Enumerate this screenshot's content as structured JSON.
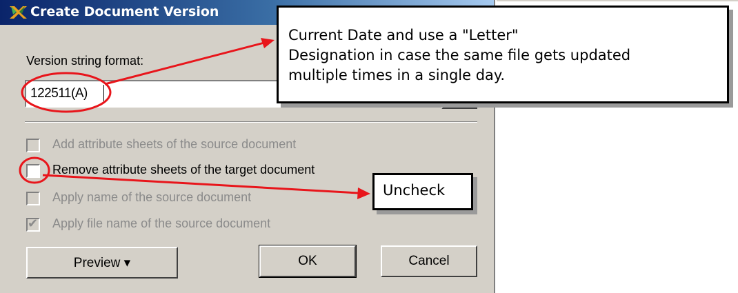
{
  "dialog": {
    "title": "Create Document Version",
    "version_label": "Version string format:",
    "version_value": "122511(A)",
    "checkboxes": [
      {
        "label": "Add attribute sheets of the source document",
        "checked": false,
        "enabled": false
      },
      {
        "label": "Remove attribute sheets of the target document",
        "checked": false,
        "enabled": true
      },
      {
        "label": "Apply name of the source document",
        "checked": false,
        "enabled": false
      },
      {
        "label": "Apply file name of the source document",
        "checked": true,
        "enabled": false
      }
    ],
    "buttons": {
      "preview": "Preview ▾",
      "ok": "OK",
      "cancel": "Cancel"
    }
  },
  "annotations": {
    "callout_1": {
      "lines": [
        "Current Date and use a \"Letter\"",
        "Designation in case the same file gets updated",
        "multiple times in a single day."
      ]
    },
    "callout_2": {
      "text": "Uncheck"
    }
  },
  "colors": {
    "dialog_face": "#d4d0c8",
    "title_gradient_start": "#0a246a",
    "annotation_red": "#e8151b",
    "disabled_text": "#8b8b8b"
  }
}
